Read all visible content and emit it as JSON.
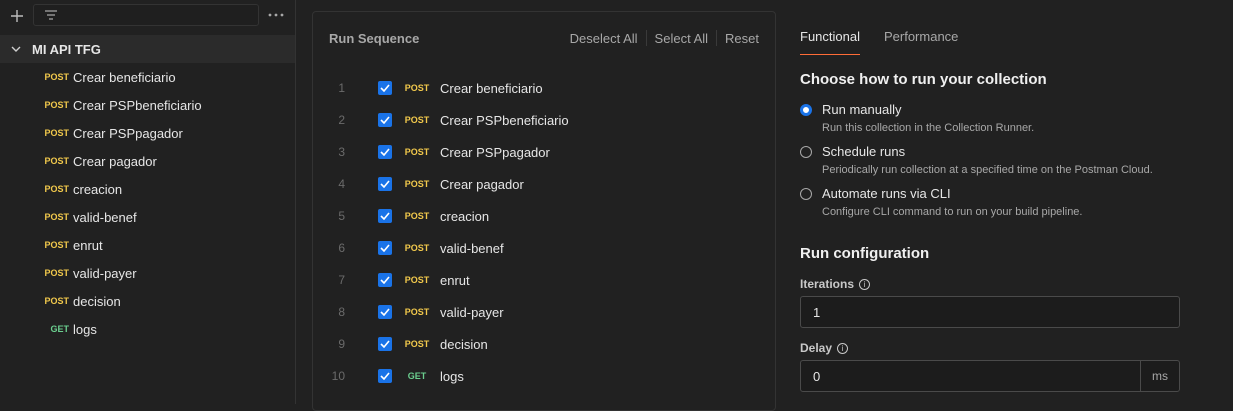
{
  "sidebar": {
    "collection_name": "MI API TFG",
    "items": [
      {
        "method": "POST",
        "label": "Crear beneficiario"
      },
      {
        "method": "POST",
        "label": "Crear PSPbeneficiario"
      },
      {
        "method": "POST",
        "label": "Crear PSPpagador"
      },
      {
        "method": "POST",
        "label": "Crear pagador"
      },
      {
        "method": "POST",
        "label": "creacion"
      },
      {
        "method": "POST",
        "label": "valid-benef"
      },
      {
        "method": "POST",
        "label": "enrut"
      },
      {
        "method": "POST",
        "label": "valid-payer"
      },
      {
        "method": "POST",
        "label": "decision"
      },
      {
        "method": "GET",
        "label": "logs"
      }
    ]
  },
  "run_sequence": {
    "title": "Run Sequence",
    "deselect_all": "Deselect All",
    "select_all": "Select All",
    "reset": "Reset",
    "rows": [
      {
        "num": "1",
        "method": "POST",
        "label": "Crear beneficiario",
        "checked": true
      },
      {
        "num": "2",
        "method": "POST",
        "label": "Crear PSPbeneficiario",
        "checked": true
      },
      {
        "num": "3",
        "method": "POST",
        "label": "Crear PSPpagador",
        "checked": true
      },
      {
        "num": "4",
        "method": "POST",
        "label": "Crear pagador",
        "checked": true
      },
      {
        "num": "5",
        "method": "POST",
        "label": "creacion",
        "checked": true
      },
      {
        "num": "6",
        "method": "POST",
        "label": "valid-benef",
        "checked": true
      },
      {
        "num": "7",
        "method": "POST",
        "label": "enrut",
        "checked": true
      },
      {
        "num": "8",
        "method": "POST",
        "label": "valid-payer",
        "checked": true
      },
      {
        "num": "9",
        "method": "POST",
        "label": "decision",
        "checked": true
      },
      {
        "num": "10",
        "method": "GET",
        "label": "logs",
        "checked": true
      }
    ]
  },
  "tabs": {
    "functional": "Functional",
    "performance": "Performance"
  },
  "run_options": {
    "heading": "Choose how to run your collection",
    "manual": {
      "title": "Run manually",
      "desc": "Run this collection in the Collection Runner.",
      "selected": true
    },
    "schedule": {
      "title": "Schedule runs",
      "desc": "Periodically run collection at a specified time on the Postman Cloud.",
      "selected": false
    },
    "cli": {
      "title": "Automate runs via CLI",
      "desc": "Configure CLI command to run on your build pipeline.",
      "selected": false
    }
  },
  "config": {
    "heading": "Run configuration",
    "iterations_label": "Iterations",
    "iterations_value": "1",
    "delay_label": "Delay",
    "delay_value": "0",
    "delay_unit": "ms"
  },
  "colors": {
    "post": "#f2c94c",
    "get": "#6bcf8f",
    "accent": "#1a73e8",
    "tab_underline": "#ff6c37"
  },
  "icons": {
    "add": "plus-icon",
    "filter": "filter-icon",
    "more": "more-horizontal-icon",
    "chevron": "chevron-down-icon",
    "info": "info-icon",
    "check": "check-icon"
  }
}
